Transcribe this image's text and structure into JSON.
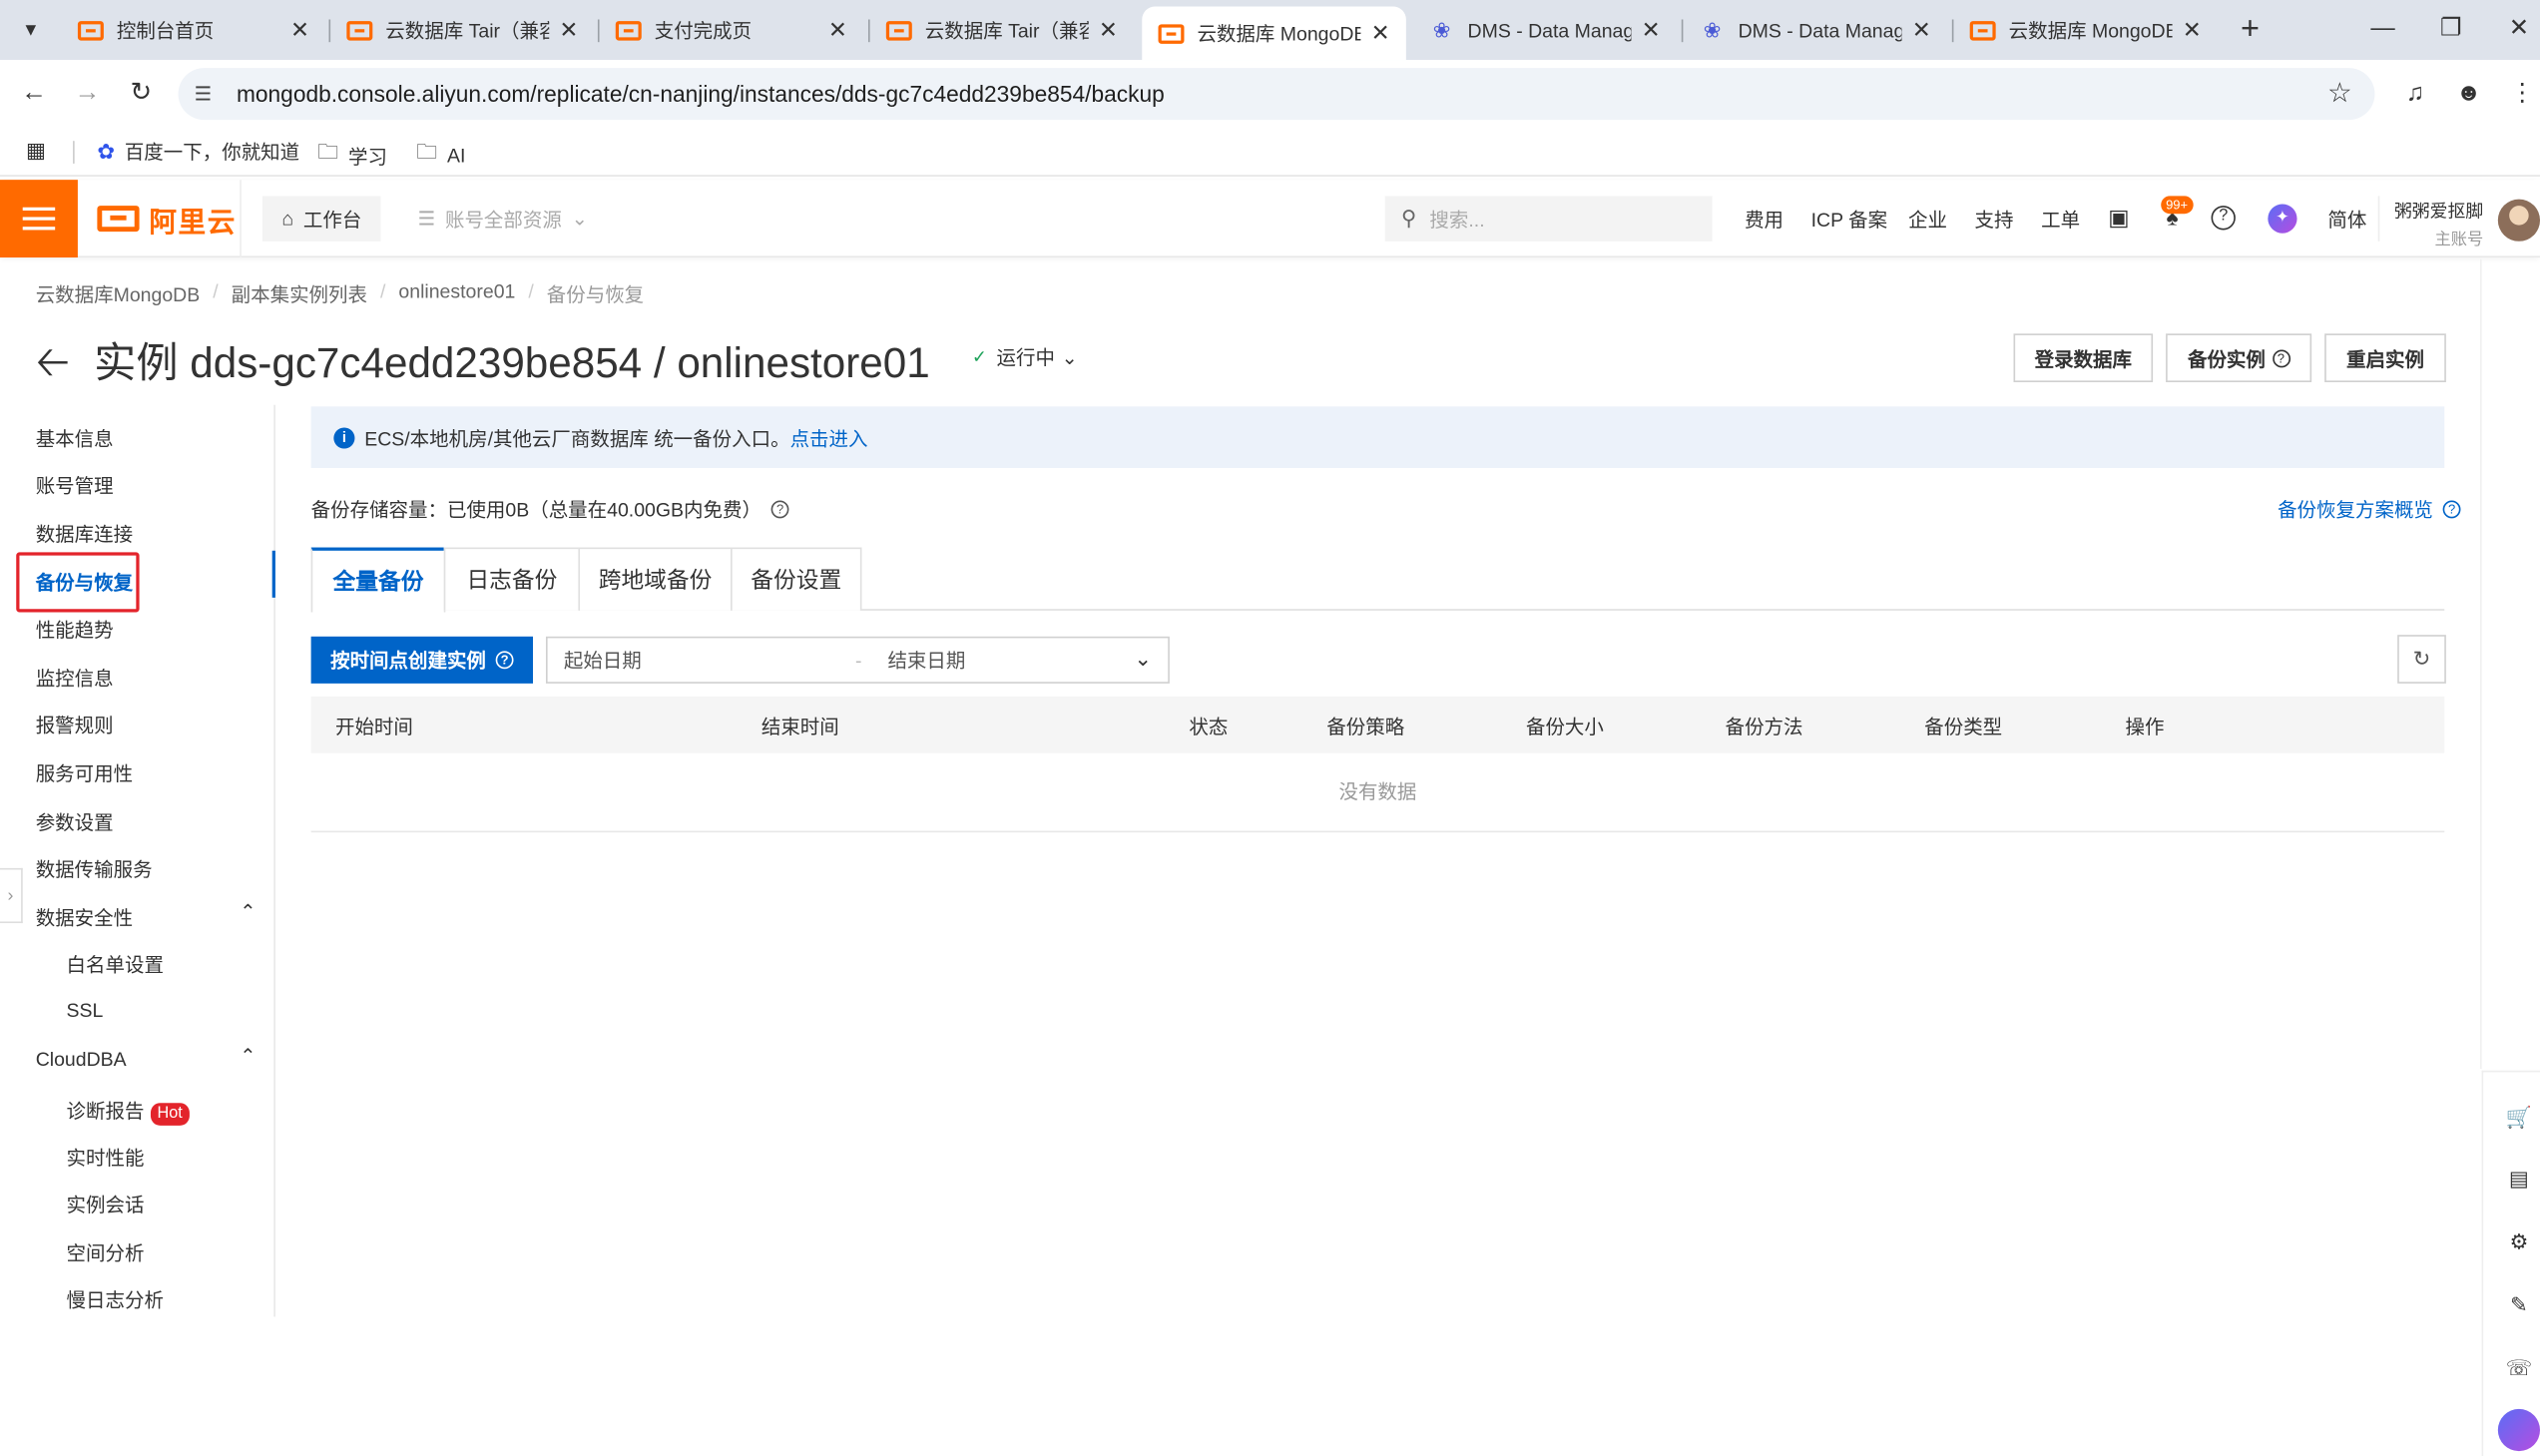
{
  "browser": {
    "tabs": [
      {
        "title": "控制台首页",
        "favicon": "aliyun-icon"
      },
      {
        "title": "云数据库 Tair（兼容",
        "favicon": "aliyun-icon"
      },
      {
        "title": "支付完成页",
        "favicon": "aliyun-icon"
      },
      {
        "title": "云数据库 Tair（兼容",
        "favicon": "aliyun-icon"
      },
      {
        "title": "云数据库 MongoDB",
        "favicon": "aliyun-icon",
        "active": true
      },
      {
        "title": "DMS - Data Manag",
        "favicon": "dms-icon"
      },
      {
        "title": "DMS - Data Manag",
        "favicon": "dms-icon"
      },
      {
        "title": "云数据库 MongoDB",
        "favicon": "aliyun-icon"
      }
    ],
    "url": "mongodb.console.aliyun.com/replicate/cn-nanjing/instances/dds-gc7c4edd239be854/backup",
    "bookmarks": [
      {
        "label": "百度一下，你就知道",
        "icon": "baidu-icon"
      },
      {
        "label": "学习",
        "icon": "folder-icon"
      },
      {
        "label": "AI",
        "icon": "folder-icon"
      }
    ]
  },
  "topnav": {
    "logo_text": "阿里云",
    "workbench": "工作台",
    "resource": "账号全部资源",
    "search_placeholder": "搜索...",
    "links": [
      "费用",
      "ICP 备案",
      "企业",
      "支持",
      "工单"
    ],
    "notification_badge": "99+",
    "lang": "简体",
    "user_name": "粥粥爱抠脚",
    "user_role": "主账号",
    "accent_color": "#ff6a00"
  },
  "breadcrumb": [
    "云数据库MongoDB",
    "副本集实例列表",
    "onlinestore01",
    "备份与恢复"
  ],
  "header": {
    "title": "实例 dds-gc7c4edd239be854 / onlinestore01",
    "status": "运行中",
    "buttons": {
      "login": "登录数据库",
      "backup": "备份实例",
      "restart": "重启实例"
    }
  },
  "sidemenu": {
    "items": [
      "基本信息",
      "账号管理",
      "数据库连接",
      "备份与恢复",
      "性能趋势",
      "监控信息",
      "报警规则",
      "服务可用性",
      "参数设置",
      "数据传输服务"
    ],
    "security_group": "数据安全性",
    "security_items": [
      "白名单设置",
      "SSL"
    ],
    "clouddba_group": "CloudDBA",
    "clouddba_items": [
      "诊断报告",
      "实时性能",
      "实例会话",
      "空间分析",
      "慢日志分析"
    ],
    "hot_badge": "Hot"
  },
  "main": {
    "notice_text": "ECS/本地机房/其他云厂商数据库 统一备份入口。",
    "notice_link": "点击进入",
    "storage_text": "备份存储容量：已使用0B（总量在40.00GB内免费）",
    "overview_link": "备份恢复方案概览",
    "tabs": [
      "全量备份",
      "日志备份",
      "跨地域备份",
      "备份设置"
    ],
    "create_button": "按时间点创建实例",
    "date_start_placeholder": "起始日期",
    "date_end_placeholder": "结束日期",
    "date_separator": "-",
    "table_headers": [
      "开始时间",
      "结束时间",
      "状态",
      "备份策略",
      "备份大小",
      "备份方法",
      "备份类型",
      "操作"
    ],
    "empty_text": "没有数据"
  }
}
